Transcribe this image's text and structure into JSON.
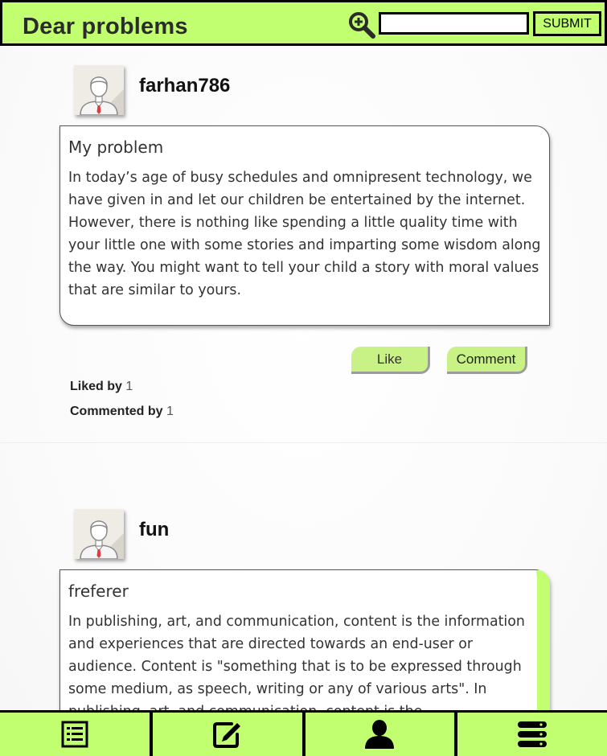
{
  "header": {
    "title": "Dear problems",
    "search_placeholder": "",
    "search_value": "",
    "submit_label": "SUBMIT",
    "search_icon": "zoom-in-search-icon"
  },
  "posts": [
    {
      "username": "farhan786",
      "avatar_icon": "user-avatar-icon",
      "title": "My problem",
      "body": "In today’s age of busy schedules and omnipresent technology, we have given in and let our children be entertained by the internet. However, there is nothing like spending a little quality time with your little one with some stories and imparting some wisdom along the way. You might want to tell your child a story with moral values that are similar to yours.",
      "like_label": "Like",
      "comment_label": "Comment",
      "liked_by_label": "Liked by",
      "liked_by_count": "1",
      "commented_by_label": "Commented by",
      "commented_by_count": "1"
    },
    {
      "username": "fun",
      "avatar_icon": "user-avatar-icon",
      "title": "freferer",
      "body": "In publishing, art, and communication, content is the information and experiences that are directed towards an end-user or audience. Content is \"something that is to be expressed through some medium, as speech, writing or any of various arts\". In publishing, art, and communication, content is the"
    }
  ],
  "bottom_nav": [
    {
      "name": "feed",
      "icon": "list-icon"
    },
    {
      "name": "write",
      "icon": "edit-icon"
    },
    {
      "name": "profile",
      "icon": "user-icon"
    },
    {
      "name": "menu",
      "icon": "server-menu-icon"
    }
  ],
  "colors": {
    "accent": "#c2ff70",
    "button": "#c8f285",
    "border": "#000000"
  }
}
